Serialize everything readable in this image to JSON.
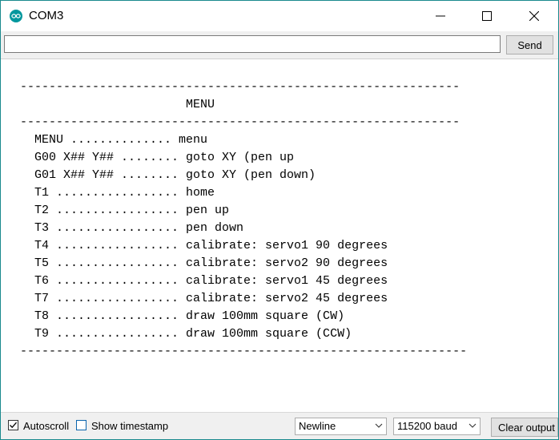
{
  "window": {
    "title": "COM3"
  },
  "input": {
    "value": "",
    "send_label": "Send"
  },
  "output": {
    "lines": [
      "-------------------------------------------------------------",
      "                       MENU",
      "-------------------------------------------------------------",
      "  MENU .............. menu",
      "  G00 X## Y## ........ goto XY (pen up",
      "  G01 X## Y## ........ goto XY (pen down)",
      "  T1 ................. home",
      "  T2 ................. pen up",
      "  T3 ................. pen down",
      "  T4 ................. calibrate: servo1 90 degrees",
      "  T5 ................. calibrate: servo2 90 degrees",
      "  T6 ................. calibrate: servo1 45 degrees",
      "  T7 ................. calibrate: servo2 45 degrees",
      "  T8 ................. draw 100mm square (CW)",
      "  T9 ................. draw 100mm square (CCW)",
      "--------------------------------------------------------------"
    ]
  },
  "statusbar": {
    "autoscroll_label": "Autoscroll",
    "autoscroll_checked": true,
    "timestamp_label": "Show timestamp",
    "timestamp_checked": false,
    "line_ending": "Newline",
    "baud": "115200 baud",
    "clear_label": "Clear output"
  },
  "colors": {
    "accent": "#00979d",
    "window_border": "#1a8a8e"
  },
  "icons": {
    "app": "arduino-icon",
    "minimize": "minimize-icon",
    "maximize": "maximize-icon",
    "close": "close-icon",
    "check": "check-icon",
    "dropdown": "chevron-down-icon"
  }
}
